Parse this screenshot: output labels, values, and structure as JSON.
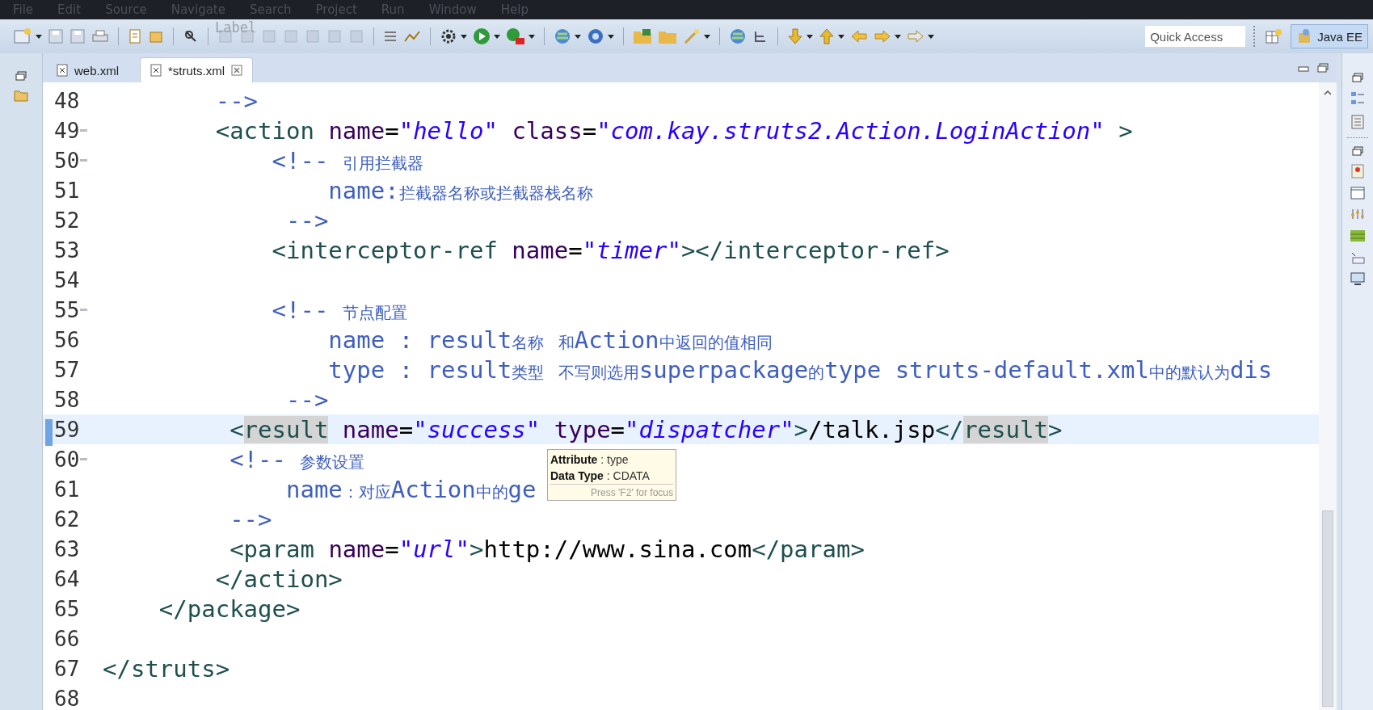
{
  "menu": [
    "File",
    "Edit",
    "Source",
    "Navigate",
    "Search",
    "Project",
    "Run",
    "Window",
    "Help"
  ],
  "toolbar": {
    "floating_label": "Label",
    "quick_access": {
      "placeholder": "Quick Access"
    },
    "perspective": {
      "label": "Java EE",
      "selected": true
    }
  },
  "tabs": [
    {
      "label": "web.xml",
      "selected": false,
      "dirty": false
    },
    {
      "label": "*struts.xml",
      "selected": true,
      "dirty": true
    }
  ],
  "editor": {
    "lines": [
      {
        "number": "48",
        "folding": false,
        "current": false,
        "segments": [
          {
            "kind": "comment",
            "text": "        -->"
          }
        ]
      },
      {
        "number": "49",
        "folding": true,
        "current": false,
        "segments": [
          {
            "kind": "tag",
            "text": "        <action"
          },
          {
            "kind": "attr",
            "text": " name"
          },
          {
            "kind": "punct",
            "text": "="
          },
          {
            "kind": "value",
            "text": "\"hello\""
          },
          {
            "kind": "attr",
            "text": " class"
          },
          {
            "kind": "punct",
            "text": "="
          },
          {
            "kind": "value",
            "text": "\"com.kay.struts2.Action.LoginAction\""
          },
          {
            "kind": "tag",
            "text": " >"
          }
        ]
      },
      {
        "number": "50",
        "folding": true,
        "current": false,
        "segments": [
          {
            "kind": "comment",
            "text": "            <!-- 引用拦截器"
          }
        ]
      },
      {
        "number": "51",
        "folding": false,
        "current": false,
        "segments": [
          {
            "kind": "comment",
            "text": "                name:拦截器名称或拦截器栈名称"
          }
        ]
      },
      {
        "number": "52",
        "folding": false,
        "current": false,
        "segments": [
          {
            "kind": "comment",
            "text": "             -->"
          }
        ]
      },
      {
        "number": "53",
        "folding": false,
        "current": false,
        "segments": [
          {
            "kind": "tag",
            "text": "            <interceptor-ref"
          },
          {
            "kind": "attr",
            "text": " name"
          },
          {
            "kind": "punct",
            "text": "="
          },
          {
            "kind": "value",
            "text": "\"timer\""
          },
          {
            "kind": "tag",
            "text": "></interceptor-ref>"
          }
        ]
      },
      {
        "number": "54",
        "folding": false,
        "current": false
      },
      {
        "number": "55",
        "folding": true,
        "current": false,
        "segments": [
          {
            "kind": "comment",
            "text": "            <!-- 节点配置"
          }
        ]
      },
      {
        "number": "56",
        "folding": false,
        "current": false,
        "segments": [
          {
            "kind": "comment",
            "text": "                name : result名称 和Action中返回的值相同"
          }
        ]
      },
      {
        "number": "57",
        "folding": false,
        "current": false,
        "segments": [
          {
            "kind": "comment",
            "text": "                type : result类型 不写则选用superpackage的type struts-default.xml中的默认为dis"
          }
        ]
      },
      {
        "number": "58",
        "folding": false,
        "current": false,
        "segments": [
          {
            "kind": "comment",
            "text": "             -->"
          }
        ]
      },
      {
        "number": "59",
        "folding": false,
        "current": true,
        "segments": [
          {
            "kind": "tag",
            "text": "         <"
          },
          {
            "kind": "tag-occurrence",
            "text": "result"
          },
          {
            "kind": "attr",
            "text": " name"
          },
          {
            "kind": "punct",
            "text": "="
          },
          {
            "kind": "value",
            "text": "\"success\""
          },
          {
            "kind": "attr",
            "text": " type"
          },
          {
            "kind": "punct",
            "text": "="
          },
          {
            "kind": "value",
            "text": "\"dispatcher\""
          },
          {
            "kind": "tag",
            "text": ">"
          },
          {
            "kind": "text",
            "text": "/talk.jsp"
          },
          {
            "kind": "tag",
            "text": "</"
          },
          {
            "kind": "tag-occurrence",
            "text": "result"
          },
          {
            "kind": "tag",
            "text": ">"
          }
        ]
      },
      {
        "number": "60",
        "folding": true,
        "current": false,
        "segments": [
          {
            "kind": "comment",
            "text": "         <!-- 参数设置"
          }
        ]
      },
      {
        "number": "61",
        "folding": false,
        "current": false,
        "segments": [
          {
            "kind": "comment",
            "text": "             name：对应Action中的ge"
          }
        ]
      },
      {
        "number": "62",
        "folding": false,
        "current": false,
        "segments": [
          {
            "kind": "comment",
            "text": "         -->"
          }
        ]
      },
      {
        "number": "63",
        "folding": false,
        "current": false,
        "segments": [
          {
            "kind": "tag",
            "text": "         <param"
          },
          {
            "kind": "attr",
            "text": " name"
          },
          {
            "kind": "punct",
            "text": "="
          },
          {
            "kind": "value",
            "text": "\"url\""
          },
          {
            "kind": "tag",
            "text": ">"
          },
          {
            "kind": "text",
            "text": "http://www.sina.com"
          },
          {
            "kind": "tag",
            "text": "</param>"
          }
        ]
      },
      {
        "number": "64",
        "folding": false,
        "current": false,
        "segments": [
          {
            "kind": "tag",
            "text": "        </action>"
          }
        ]
      },
      {
        "number": "65",
        "folding": false,
        "current": false,
        "segments": [
          {
            "kind": "tag",
            "text": "    </package>"
          }
        ]
      },
      {
        "number": "66",
        "folding": false,
        "current": false
      },
      {
        "number": "67",
        "folding": false,
        "current": false,
        "segments": [
          {
            "kind": "tag",
            "text": "</struts>"
          }
        ]
      },
      {
        "number": "68",
        "folding": false,
        "current": false
      }
    ],
    "hover": {
      "rows": [
        {
          "label": "Attribute",
          "separator": " : ",
          "value": "type"
        },
        {
          "label": "Data Type",
          "separator": " : ",
          "value": "CDATA"
        }
      ],
      "footer": "Press 'F2' for focus"
    }
  }
}
